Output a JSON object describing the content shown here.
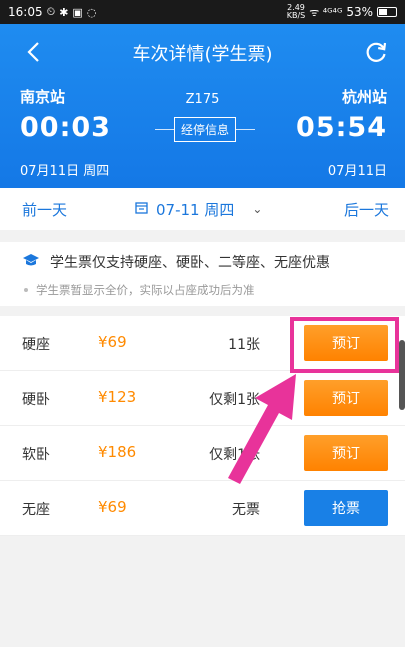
{
  "status_bar": {
    "time": "16:05",
    "speed": "2.49",
    "speed_unit": "KB/S",
    "signal": "ᯤ ⁴ᴳ⁴ᴳ",
    "battery": "53%",
    "battery_level": 0.53
  },
  "nav": {
    "title": "车次详情(学生票)"
  },
  "trip": {
    "from_station": "南京站",
    "to_station": "杭州站",
    "train_no": "Z175",
    "depart_time": "00:03",
    "arrive_time": "05:54",
    "depart_date": "07月11日 周四",
    "arrive_date": "07月11日",
    "stops_label": "经停信息"
  },
  "date_bar": {
    "prev": "前一天",
    "current": "07-11 周四",
    "next": "后一天"
  },
  "notice": {
    "main": "学生票仅支持硬座、硬卧、二等座、无座优惠",
    "sub": "学生票暂显示全价，实际以占座成功后为准"
  },
  "seats": [
    {
      "type": "硬座",
      "price": "¥69",
      "count": "11张",
      "button": "预订",
      "kind": "book"
    },
    {
      "type": "硬卧",
      "price": "¥123",
      "count": "仅剩1张",
      "button": "预订",
      "kind": "book"
    },
    {
      "type": "软卧",
      "price": "¥186",
      "count": "仅剩1张",
      "button": "预订",
      "kind": "book"
    },
    {
      "type": "无座",
      "price": "¥69",
      "count": "无票",
      "button": "抢票",
      "kind": "grab"
    }
  ],
  "colors": {
    "header_blue": "#1f8cf0",
    "book_orange": "#ff8a00",
    "grab_blue": "#1980e6",
    "highlight_pink": "#e8339a"
  }
}
